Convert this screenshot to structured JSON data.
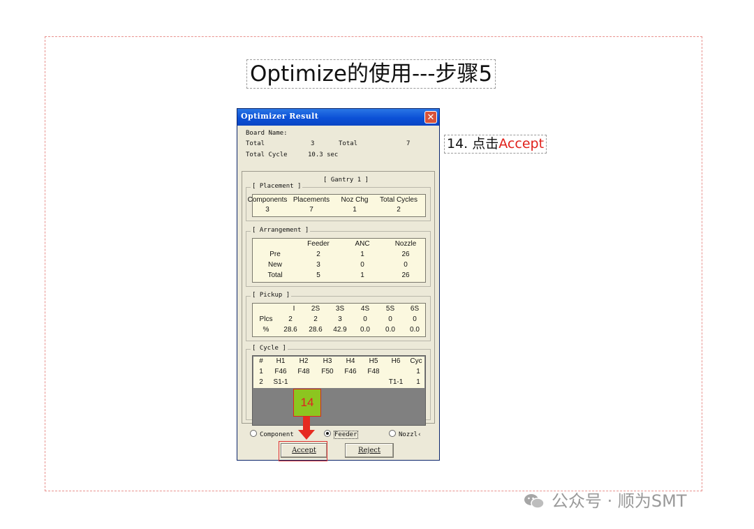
{
  "slide": {
    "title": "Optimize的使用---步骤5",
    "callout_prefix": "14. 点击",
    "callout_highlight": "Accept",
    "step_badge": "14",
    "watermark_name": "公众号 · 顺为SMT"
  },
  "dialog": {
    "title": "Optimizer Result",
    "close_glyph": "✕",
    "board_label": "Board Name:",
    "total_label_1": "Total",
    "total_value_1": "3",
    "total_label_2": "Total",
    "total_value_2": "7",
    "total_cycle_label": "Total Cycle",
    "total_cycle_value": "10.3 sec",
    "gantry_label": "[ Gantry  1 ]",
    "placement": {
      "legend": "[ Placement ]",
      "headers": [
        "Components",
        "Placements",
        "Noz Chg",
        "Total Cycles"
      ],
      "values": [
        "3",
        "7",
        "1",
        "2"
      ]
    },
    "arrangement": {
      "legend": "[ Arrangement ]",
      "headers": [
        "Feeder",
        "ANC",
        "Nozzle"
      ],
      "rows": [
        {
          "label": "Pre",
          "values": [
            "2",
            "1",
            "26"
          ]
        },
        {
          "label": "New",
          "values": [
            "3",
            "0",
            "0"
          ]
        },
        {
          "label": "Total",
          "values": [
            "5",
            "1",
            "26"
          ]
        }
      ]
    },
    "pickup": {
      "legend": "[ Pickup ]",
      "headers": [
        "I",
        "2S",
        "3S",
        "4S",
        "5S",
        "6S"
      ],
      "rows": [
        {
          "label": "Plcs",
          "values": [
            "2",
            "2",
            "3",
            "0",
            "0",
            "0"
          ]
        },
        {
          "label": "%",
          "values": [
            "28.6",
            "28.6",
            "42.9",
            "0.0",
            "0.0",
            "0.0"
          ]
        }
      ]
    },
    "cycle": {
      "legend": "[ Cycle ]",
      "headers": [
        "#",
        "H1",
        "H2",
        "H3",
        "H4",
        "H5",
        "H6",
        "Cyc"
      ],
      "rows": [
        [
          "1",
          "F46",
          "F48",
          "F50",
          "F46",
          "F48",
          "",
          "1"
        ],
        [
          "2",
          "S1-1",
          "",
          "",
          "",
          "",
          "T1-1",
          "1"
        ]
      ]
    },
    "radios": [
      {
        "label": "Component",
        "selected": false
      },
      {
        "label": "Feeder",
        "selected": true
      },
      {
        "label": "Nozzl‹",
        "selected": false
      }
    ],
    "accept_label": "Accept",
    "reject_label": "Reject"
  },
  "colors": {
    "dialog_titlebar": "#0b50d6",
    "highlight_red": "#e0201a",
    "badge_green": "#8cc520"
  },
  "icons": [
    "close-icon",
    "wechat-logo-icon",
    "down-arrow-icon"
  ]
}
